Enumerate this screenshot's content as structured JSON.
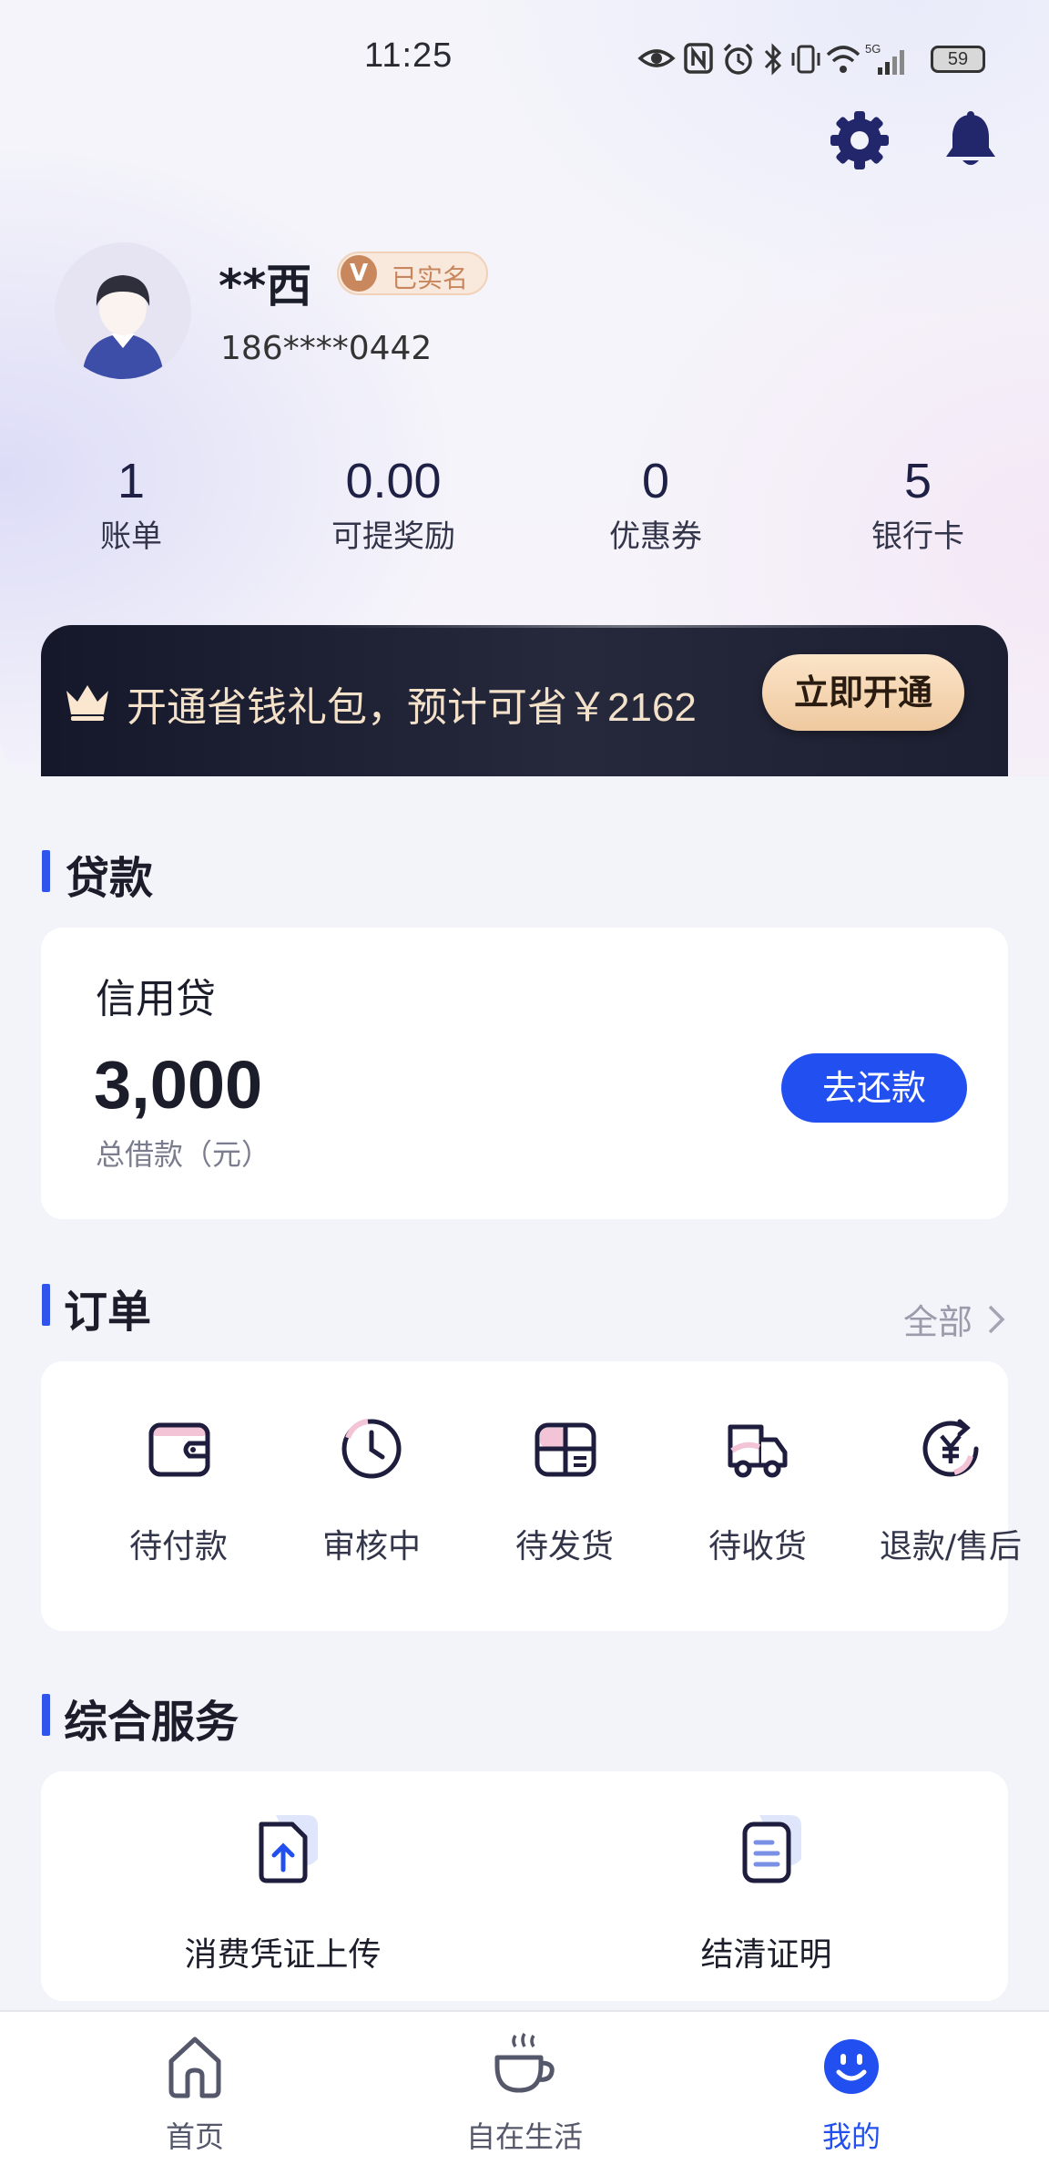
{
  "status_bar": {
    "time": "11:25",
    "network": "5G",
    "battery": "59"
  },
  "header": {
    "settings_icon": "gear-icon",
    "notification_icon": "bell-icon"
  },
  "profile": {
    "name": "**西",
    "verified_badge_letter": "V",
    "verified_label": "已实名",
    "phone": "186****0442"
  },
  "stats": [
    {
      "value": "1",
      "label": "账单"
    },
    {
      "value": "0.00",
      "label": "可提奖励"
    },
    {
      "value": "0",
      "label": "优惠券"
    },
    {
      "value": "5",
      "label": "银行卡"
    }
  ],
  "promo": {
    "text": "开通省钱礼包，预计可省",
    "amount": "￥2162",
    "button": "立即开通",
    "icon": "crown-icon"
  },
  "loan": {
    "section_title": "贷款",
    "product": "信用贷",
    "amount": "3,000",
    "amount_label": "总借款（元）",
    "button": "去还款"
  },
  "orders": {
    "section_title": "订单",
    "view_all": "全部",
    "items": [
      {
        "label": "待付款",
        "icon": "wallet-icon"
      },
      {
        "label": "审核中",
        "icon": "clock-icon"
      },
      {
        "label": "待发货",
        "icon": "package-icon"
      },
      {
        "label": "待收货",
        "icon": "truck-icon"
      },
      {
        "label": "退款/售后",
        "icon": "refund-yen-icon"
      }
    ]
  },
  "services": {
    "section_title": "综合服务",
    "items": [
      {
        "label": "消费凭证上传",
        "icon": "upload-document-icon"
      },
      {
        "label": "结清证明",
        "icon": "certificate-document-icon"
      }
    ]
  },
  "tabbar": {
    "accent": "#2250f0",
    "items": [
      {
        "label": "首页",
        "icon": "home-icon",
        "active": false
      },
      {
        "label": "自在生活",
        "icon": "coffee-cup-icon",
        "active": false
      },
      {
        "label": "我的",
        "icon": "smiley-icon",
        "active": true
      }
    ]
  }
}
